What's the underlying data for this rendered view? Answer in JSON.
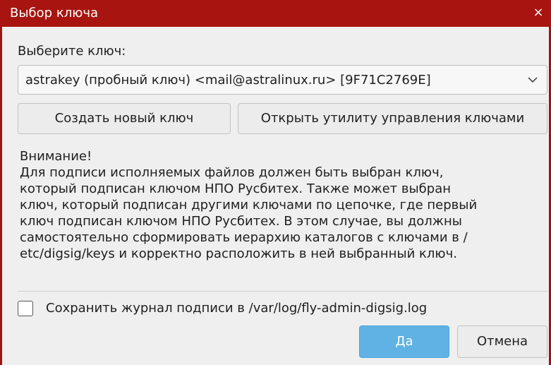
{
  "window": {
    "title": "Выбор ключа",
    "close_glyph": "×",
    "accent_color": "#a8140f"
  },
  "key_select": {
    "label": "Выберите ключ:",
    "selected_value": "astrakey (пробный ключ) <mail@astralinux.ru> [9F71C2769E]",
    "arrow_icon": "chevron-down-icon"
  },
  "buttons": {
    "create_key": "Создать новый ключ",
    "open_utility": "Открыть утилиту управления ключами",
    "yes": "Да",
    "cancel": "Отмена",
    "yes_color": "#5fb2e3"
  },
  "warning": {
    "heading": "Внимание!",
    "lines": [
      "Для подписи исполняемых файлов должен быть выбран ключ,",
      "который подписан ключом НПО Русбитех. Также может выбран",
      "ключ, который подписан другими ключами по цепочке, где первый",
      "ключ подписан ключом НПО Русбитех. В этом случае, вы должны",
      "самостоятельно сформировать иерархию каталогов с ключами в /",
      "etc/digsig/keys и корректно расположить в ней выбранный ключ."
    ]
  },
  "save_log": {
    "label": "Сохранить журнал подписи в /var/log/fly-admin-digsig.log",
    "checked": false
  }
}
